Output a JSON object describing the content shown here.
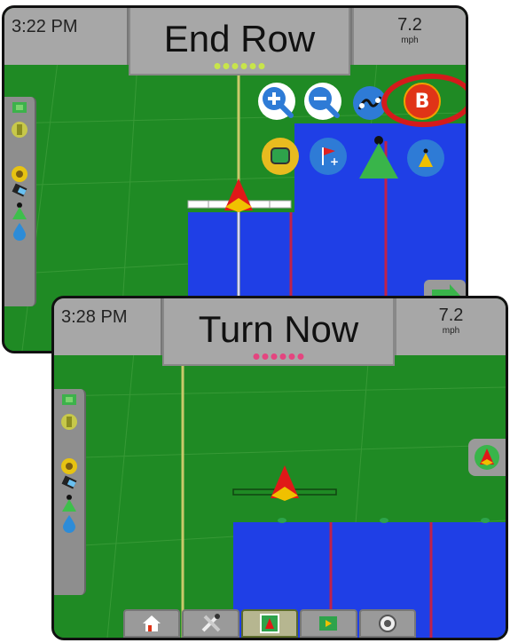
{
  "screen1": {
    "time": "3:22 PM",
    "title": "End Row",
    "speed": {
      "value": "7.2",
      "unit": "mph"
    },
    "status_dot_color": "#c8e54a",
    "map_buttons": [
      {
        "icon": "zoom-in-icon"
      },
      {
        "icon": "zoom-out-icon"
      },
      {
        "icon": "guidance-line-icon"
      },
      {
        "icon": "b-point-icon",
        "label": "B",
        "highlighted": true
      },
      {
        "icon": "boundary-icon"
      },
      {
        "icon": "marker-flag-icon"
      },
      {
        "icon": "vehicle-view-icon"
      },
      {
        "icon": "perspective-view-icon"
      }
    ],
    "next_arrow_icon": "arrow-right-icon"
  },
  "screen2": {
    "time": "3:28 PM",
    "title": "Turn Now",
    "speed": {
      "value": "7.2",
      "unit": "mph"
    },
    "status_dot_color": "#e4457f",
    "side_button_icon": "vehicle-view-icon",
    "bottom_nav": [
      {
        "icon": "home-icon",
        "active": false
      },
      {
        "icon": "tools-icon",
        "active": false
      },
      {
        "icon": "guidance-view-icon",
        "active": true
      },
      {
        "icon": "map-view-icon",
        "active": false
      },
      {
        "icon": "settings-icon",
        "active": false
      }
    ]
  },
  "colors": {
    "field_green": "#1f8a24",
    "coverage_blue": "#1f3fe6",
    "guidance_line": "#c9c96a",
    "highlight_ring": "#d41b1b"
  }
}
